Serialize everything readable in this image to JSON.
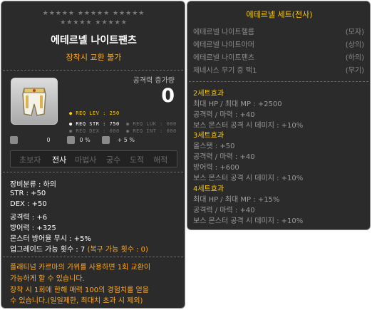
{
  "item": {
    "stars_row1": "★★★★★ ★★★★★ ★★★★★",
    "stars_row2": "★★★★★ ★★★★★",
    "name": "에테르넬 나이트팬츠",
    "trade_note": "장착시 교환 불가",
    "attack_label": "공격력 증가량",
    "attack_value": "0",
    "icon": "pants-armor-icon",
    "requirements": {
      "lev": "● REQ LEV : 250",
      "str": "● REQ STR : 750",
      "dex": "● REQ DEX : 000",
      "luk": "● REQ LUK : 000",
      "int": "● REQ INT : 000"
    },
    "mini_stats": {
      "left": "0",
      "mid": "0 %",
      "right": "+ 5 %"
    },
    "jobs": [
      {
        "label": "초보자",
        "active": false
      },
      {
        "label": "전사",
        "active": true
      },
      {
        "label": "마법사",
        "active": false
      },
      {
        "label": "궁수",
        "active": false
      },
      {
        "label": "도적",
        "active": false
      },
      {
        "label": "해적",
        "active": false
      }
    ],
    "stats": [
      "장비분류 : 하의",
      "STR : +50",
      "DEX : +50",
      "공격력 : +6",
      "방어력 : +325",
      "몬스터 방어율 무시 : +5%"
    ],
    "upgrade": {
      "text": "업그레이드 가능 횟수 : 7 ",
      "recover": "(복구 가능 횟수 : 0)"
    },
    "description": [
      "플래티넘 카르마의 가위를 사용하면 1회 교환이",
      "가능하게 할 수 있습니다.",
      "장착 시 1회에 한해 매력 100의 경험치를 얻을",
      "수 있습니다.(일일제한, 최대치 초과 시 제외)"
    ]
  },
  "set": {
    "title": "에테르넬 세트(전사)",
    "items": [
      {
        "name": "에테르넬 나이트헬름",
        "slot": "(모자)",
        "equipped": false
      },
      {
        "name": "에테르넬 나이트아머",
        "slot": "(상의)",
        "equipped": false
      },
      {
        "name": "에테르넬 나이트팬츠",
        "slot": "(하의)",
        "equipped": false
      },
      {
        "name": "제네시스 무기 중 택1",
        "slot": "(무기)",
        "equipped": false
      }
    ],
    "bonuses": [
      {
        "title": "2세트효과",
        "lines": [
          "최대 HP / 최대 MP : +2500",
          "공격력 / 마력 : +40",
          "보스 몬스터 공격 시 데미지 : +10%"
        ]
      },
      {
        "title": "3세트효과",
        "lines": [
          "올스탯 : +50",
          "공격력 / 마력 : +40",
          "방어력 : +600",
          "보스 몬스터 공격 시 데미지 : +10%"
        ]
      },
      {
        "title": "4세트효과",
        "lines": [
          "최대 HP / 최대 MP : +15%",
          "공격력 / 마력 : +40",
          "보스 몬스터 공격 시 데미지 : +10%"
        ]
      }
    ]
  }
}
